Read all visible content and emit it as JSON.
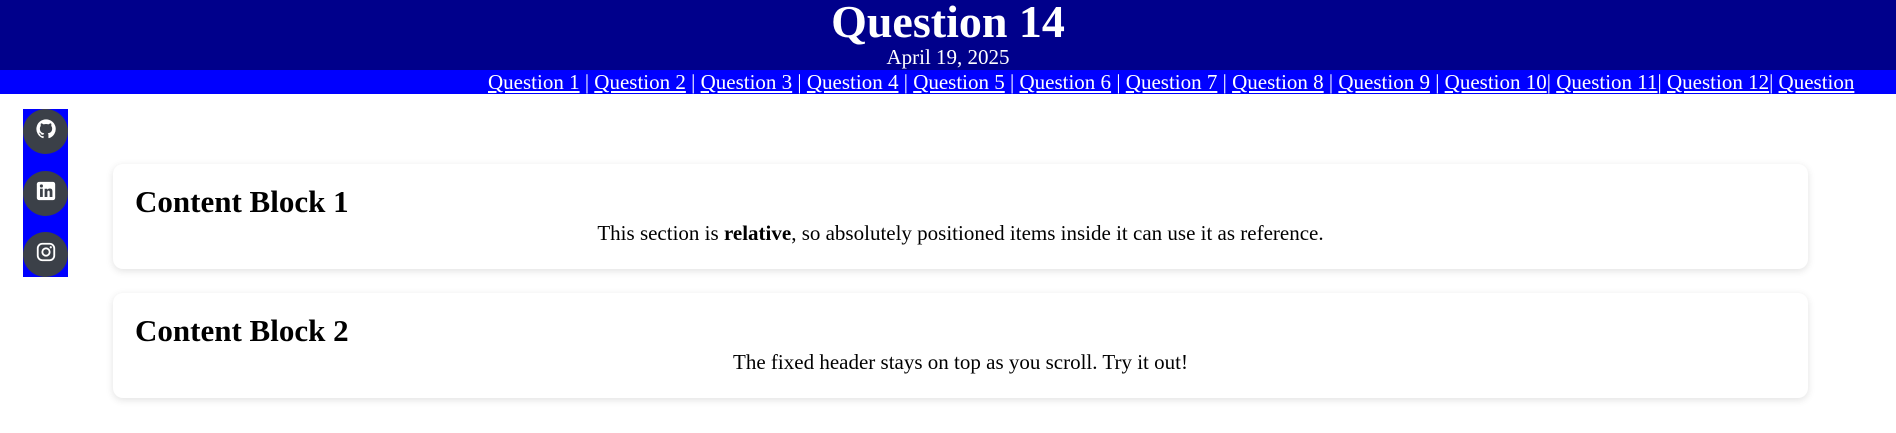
{
  "header": {
    "title": "Question 14",
    "date": "April 19, 2025"
  },
  "nav": {
    "links": [
      "Question 1",
      "Question 2",
      "Question 3",
      "Question 4",
      "Question 5",
      "Question 6",
      "Question 7",
      "Question 8",
      "Question 9",
      "Question 10",
      "Question 11",
      "Question 12",
      "Question"
    ],
    "separators": [
      " | ",
      " | ",
      " | ",
      " | ",
      " | ",
      " | ",
      " | ",
      " | ",
      " | ",
      "| ",
      "| ",
      "| ",
      ""
    ]
  },
  "social": {
    "items": [
      {
        "icon": "github-icon"
      },
      {
        "icon": "linkedin-icon"
      },
      {
        "icon": "instagram-icon"
      }
    ]
  },
  "content": {
    "block1": {
      "title": "Content Block 1",
      "text_before": "This section is ",
      "text_bold": "relative",
      "text_after": ", so absolutely positioned items inside it can use it as reference."
    },
    "block2": {
      "title": "Content Block 2",
      "text": "The fixed header stays on top as you scroll. Try it out!"
    }
  },
  "colors": {
    "header_bg": "#00008b",
    "nav_bg": "#0000ff",
    "social_bg": "#0000ff",
    "social_button": "#3b4048"
  }
}
